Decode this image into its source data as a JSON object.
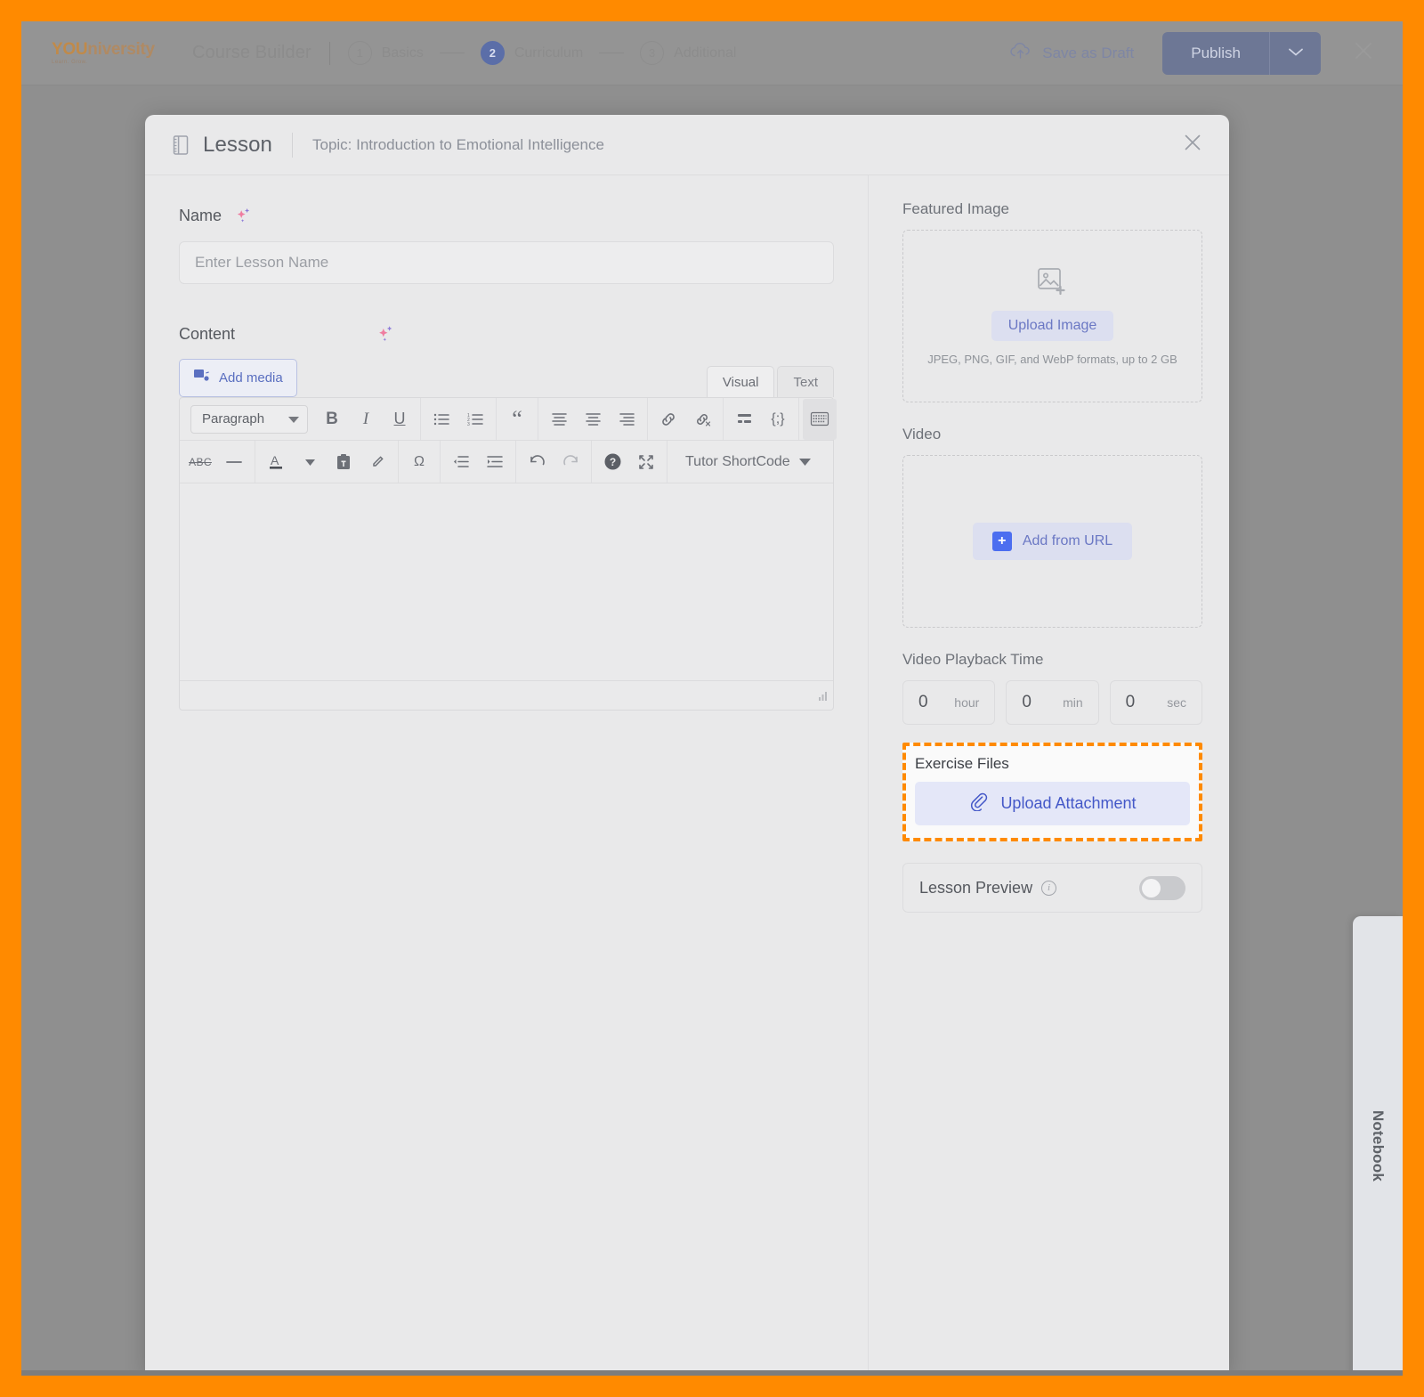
{
  "brand": {
    "logo_you": "YOU",
    "logo_rest": "niversity",
    "logo_tagline": "Learn. Grow."
  },
  "topbar": {
    "title": "Course Builder",
    "steps": [
      {
        "num": "1",
        "label": "Basics",
        "active": false
      },
      {
        "num": "2",
        "label": "Curriculum",
        "active": true
      },
      {
        "num": "3",
        "label": "Additional",
        "active": false
      }
    ],
    "save_draft_label": "Save as Draft",
    "publish_label": "Publish",
    "publish_caret_icon": "chevron-down-icon",
    "close_icon": "close-icon",
    "cloud_icon": "cloud-upload-icon"
  },
  "modal": {
    "icon": "lesson-book-icon",
    "title": "Lesson",
    "topic": "Topic: Introduction to Emotional Intelligence",
    "close_icon": "close-icon"
  },
  "form": {
    "name_label": "Name",
    "name_sparkle_icon": "ai-sparkle-icon",
    "name_placeholder": "Enter Lesson Name",
    "name_value": "",
    "content_label": "Content",
    "content_sparkle_icon": "ai-sparkle-icon",
    "add_media_label": "Add media",
    "add_media_icon": "add-media-icon",
    "tabs": [
      {
        "label": "Visual",
        "active": true
      },
      {
        "label": "Text",
        "active": false
      }
    ]
  },
  "editor_toolbar": {
    "paragraph_select": "Paragraph",
    "row1": [
      {
        "icon": "bold-icon",
        "glyph": "B"
      },
      {
        "icon": "italic-icon",
        "glyph": "I"
      },
      {
        "icon": "underline-icon",
        "glyph": "U"
      },
      {
        "icon": "bulleted-list-icon",
        "glyph": ""
      },
      {
        "icon": "numbered-list-icon",
        "glyph": ""
      },
      {
        "icon": "blockquote-icon",
        "glyph": "“"
      },
      {
        "icon": "align-left-icon",
        "glyph": ""
      },
      {
        "icon": "align-center-icon",
        "glyph": ""
      },
      {
        "icon": "align-right-icon",
        "glyph": ""
      },
      {
        "icon": "insert-link-icon",
        "glyph": ""
      },
      {
        "icon": "remove-link-icon",
        "glyph": ""
      },
      {
        "icon": "read-more-icon",
        "glyph": ""
      },
      {
        "icon": "code-shortcode-icon",
        "glyph": "{;}"
      },
      {
        "icon": "toolbar-toggle-icon",
        "glyph": ""
      }
    ],
    "row2": [
      {
        "icon": "strikethrough-icon",
        "glyph": "ABC"
      },
      {
        "icon": "horizontal-rule-icon",
        "glyph": "—"
      },
      {
        "icon": "text-color-icon",
        "glyph": "A"
      },
      {
        "icon": "text-color-caret-icon",
        "glyph": "▾"
      },
      {
        "icon": "paste-as-text-icon",
        "glyph": ""
      },
      {
        "icon": "clear-formatting-icon",
        "glyph": ""
      },
      {
        "icon": "special-character-icon",
        "glyph": "Ω"
      },
      {
        "icon": "decrease-indent-icon",
        "glyph": ""
      },
      {
        "icon": "increase-indent-icon",
        "glyph": ""
      },
      {
        "icon": "undo-icon",
        "glyph": ""
      },
      {
        "icon": "redo-icon",
        "glyph": ""
      },
      {
        "icon": "keyboard-shortcuts-icon",
        "glyph": "?"
      },
      {
        "icon": "fullscreen-icon",
        "glyph": ""
      }
    ],
    "shortcode_label": "Tutor ShortCode",
    "shortcode_caret_icon": "caret-down-icon",
    "resize_handle_icon": "resize-handle-icon",
    "editor_content": ""
  },
  "sidebar": {
    "featured_image": {
      "label": "Featured Image",
      "icon": "image-placeholder-icon",
      "button_label": "Upload Image",
      "hint": "JPEG, PNG, GIF, and WebP formats, up to 2 GB"
    },
    "video": {
      "label": "Video",
      "button_label": "Add from URL",
      "plus_icon": "plus-square-icon"
    },
    "playback": {
      "label": "Video Playback Time",
      "fields": [
        {
          "value": "0",
          "unit": "hour"
        },
        {
          "value": "0",
          "unit": "min"
        },
        {
          "value": "0",
          "unit": "sec"
        }
      ]
    },
    "exercise_files": {
      "label": "Exercise Files",
      "button_label": "Upload Attachment",
      "attachment_icon": "paperclip-icon",
      "highlight_color": "#ff8a00"
    },
    "lesson_preview": {
      "label": "Lesson Preview",
      "info_icon": "info-circle-icon",
      "toggle_state": "off"
    }
  },
  "notebook_tab": {
    "label": "Notebook"
  }
}
